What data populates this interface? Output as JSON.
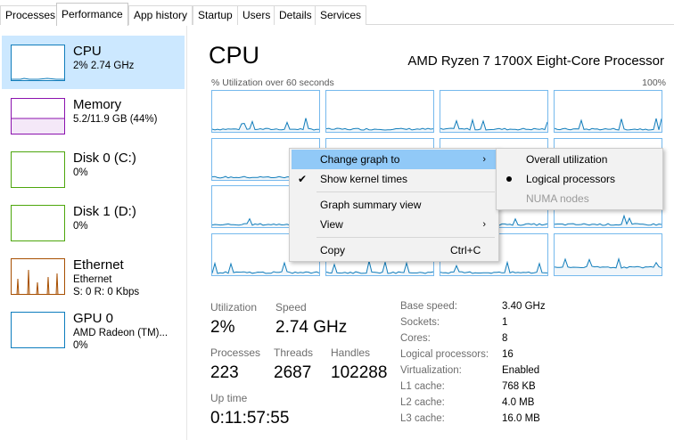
{
  "tabs": [
    {
      "label": "Processes",
      "active": false
    },
    {
      "label": "Performance",
      "active": true
    },
    {
      "label": "App history",
      "active": false
    },
    {
      "label": "Startup",
      "active": false
    },
    {
      "label": "Users",
      "active": false
    },
    {
      "label": "Details",
      "active": false
    },
    {
      "label": "Services",
      "active": false
    }
  ],
  "sidebar": {
    "items": [
      {
        "name": "CPU",
        "sub1": "2% 2.74 GHz",
        "sub2": "",
        "color": "#117dbb",
        "selected": true
      },
      {
        "name": "Memory",
        "sub1": "5.2/11.9 GB (44%)",
        "sub2": "",
        "color": "#8b12ae",
        "selected": false
      },
      {
        "name": "Disk 0 (C:)",
        "sub1": "0%",
        "sub2": "",
        "color": "#4da60c",
        "selected": false
      },
      {
        "name": "Disk 1 (D:)",
        "sub1": "0%",
        "sub2": "",
        "color": "#4da60c",
        "selected": false
      },
      {
        "name": "Ethernet",
        "sub1": "Ethernet",
        "sub2": "S: 0 R: 0 Kbps",
        "color": "#a74f01",
        "selected": false
      },
      {
        "name": "GPU 0",
        "sub1": "AMD Radeon (TM)...",
        "sub2": "0%",
        "color": "#0d7dbe",
        "selected": false
      }
    ]
  },
  "main": {
    "title": "CPU",
    "model": "AMD Ryzen 7 1700X Eight-Core Processor",
    "axis_label": "% Utilization over 60 seconds",
    "axis_max": "100%",
    "graph_color": "#117dbb"
  },
  "stats": {
    "utilization_label": "Utilization",
    "utilization": "2%",
    "speed_label": "Speed",
    "speed": "2.74 GHz",
    "processes_label": "Processes",
    "processes": "223",
    "threads_label": "Threads",
    "threads": "2687",
    "handles_label": "Handles",
    "handles": "102288",
    "uptime_label": "Up time",
    "uptime": "0:11:57:55"
  },
  "info": [
    {
      "label": "Base speed:",
      "value": "3.40 GHz"
    },
    {
      "label": "Sockets:",
      "value": "1"
    },
    {
      "label": "Cores:",
      "value": "8"
    },
    {
      "label": "Logical processors:",
      "value": "16"
    },
    {
      "label": "Virtualization:",
      "value": "Enabled"
    },
    {
      "label": "L1 cache:",
      "value": "768 KB"
    },
    {
      "label": "L2 cache:",
      "value": "4.0 MB"
    },
    {
      "label": "L3 cache:",
      "value": "16.0 MB"
    }
  ],
  "context_menu": {
    "change_graph": "Change graph to",
    "show_kernel": "Show kernel times",
    "show_kernel_checked": true,
    "summary_view": "Graph summary view",
    "view": "View",
    "copy": "Copy",
    "copy_shortcut": "Ctrl+C"
  },
  "submenu": {
    "overall": "Overall utilization",
    "logical": "Logical processors",
    "numa": "NUMA nodes",
    "selected": "Logical processors"
  }
}
